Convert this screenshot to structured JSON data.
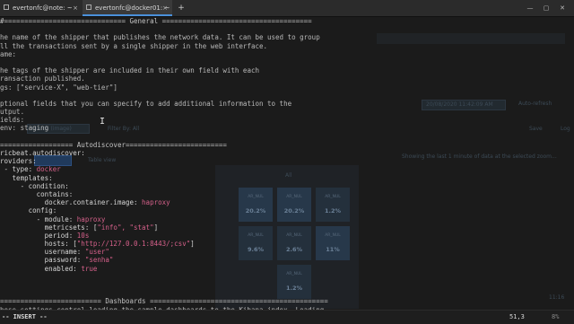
{
  "tabs": [
    {
      "label": "evertonfc@note: ~",
      "close": "×"
    },
    {
      "label": "evertonfc@docker01: ~",
      "close": "×"
    }
  ],
  "add_tab": "+",
  "window_controls": {
    "min": "—",
    "max": "▢",
    "close": "✕"
  },
  "background_browser": {
    "search_placeholder": "Search (image)",
    "filter_label": "Filter By: All",
    "view_button": "Table view",
    "timestamp": "20/08/2020 11:42:09 AM",
    "auto_refresh": "Auto-refresh",
    "save_label": "Save",
    "log_label": "Log",
    "info_text": "Showing the last 1 minute of data at the selected zoom...",
    "legend": "All",
    "tiles": [
      {
        "label": "AR_NUL",
        "value": "20.2%"
      },
      {
        "label": "AR_NUL",
        "value": "20.2%"
      },
      {
        "label": "AR_NUL",
        "value": "1.2%"
      },
      {
        "label": "AR_NUL",
        "value": "9.6%"
      },
      {
        "label": "AR_NUL",
        "value": "2.6%"
      },
      {
        "label": "AR_NUL",
        "value": "11%"
      },
      {
        "label": "AR_NUL",
        "value": "1.2%"
      }
    ],
    "corner_time": "11:16"
  },
  "terminal": {
    "lines": [
      {
        "cls": "sec-head",
        "text": "#============================== General ====================================="
      },
      {
        "cls": "txt",
        "text": ""
      },
      {
        "cls": "cmt",
        "text": "he name of the shipper that publishes the network data. It can be used to group"
      },
      {
        "cls": "cmt",
        "text": "ll the transactions sent by a single shipper in the web interface."
      },
      {
        "cls": "cmt",
        "text": "ame:"
      },
      {
        "cls": "txt",
        "text": ""
      },
      {
        "cls": "cmt",
        "text": "he tags of the shipper are included in their own field with each"
      },
      {
        "cls": "cmt",
        "text": "ransaction published."
      },
      {
        "cls": "cmt",
        "text": "gs: [\"service-X\", \"web-tier\"]"
      },
      {
        "cls": "txt",
        "text": ""
      },
      {
        "cls": "cmt",
        "text": "ptional fields that you can specify to add additional information to the"
      },
      {
        "cls": "cmt",
        "text": "utput."
      },
      {
        "cls": "cmt",
        "text": "ields:"
      },
      {
        "cls": "cmt",
        "text": "env: staging"
      },
      {
        "cls": "txt",
        "text": ""
      },
      {
        "cls": "sec-head",
        "text": "================== Autodiscover========================="
      },
      {
        "cls": "key",
        "text": "ricbeat.autodiscover:"
      },
      {
        "cls": "key",
        "text": "roviders:"
      },
      {
        "cls": "key",
        "text": " - type: ",
        "val": "docker"
      },
      {
        "cls": "key",
        "text": "   templates:"
      },
      {
        "cls": "key",
        "text": "     - condition:"
      },
      {
        "cls": "key",
        "text": "         contains:"
      },
      {
        "cls": "key",
        "text": "           docker.container.image: ",
        "val": "haproxy"
      },
      {
        "cls": "key",
        "text": "       config:"
      },
      {
        "cls": "key",
        "text": "         - module: ",
        "val": "haproxy"
      },
      {
        "cls": "key",
        "text": "           metricsets: [",
        "val": "\"info\", \"stat\"",
        "tail": "]"
      },
      {
        "cls": "key",
        "text": "           period: ",
        "val": "10s"
      },
      {
        "cls": "key",
        "text": "           hosts: [",
        "val": "\"http://127.0.0.1:8443/;csv\"",
        "tail": "]"
      },
      {
        "cls": "key",
        "text": "           username: ",
        "val": "\"user\""
      },
      {
        "cls": "key",
        "text": "           password: ",
        "val": "\"senha\""
      },
      {
        "cls": "key",
        "text": "           enabled: ",
        "val": "true"
      },
      {
        "cls": "txt",
        "text": ""
      },
      {
        "cls": "txt",
        "text": ""
      },
      {
        "cls": "txt",
        "text": ""
      },
      {
        "cls": "sec-head",
        "text": "========================= Dashboards ============================================"
      },
      {
        "cls": "cmt",
        "text": "hese settings control loading the sample dashboards to the Kibana index. Loading"
      },
      {
        "cls": "cmt",
        "text": "he dashboards is disabled by default and can be enabled either by setting the"
      }
    ]
  },
  "status_bar": {
    "mode": "-- INSERT --",
    "position": "51,3",
    "percent": "8%"
  }
}
